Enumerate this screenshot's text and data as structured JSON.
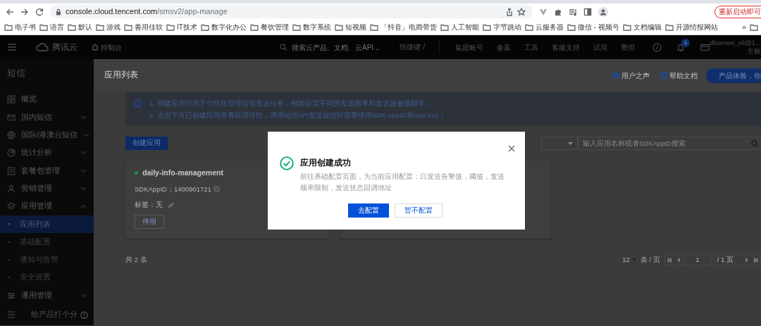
{
  "browser": {
    "url_host": "console.cloud.tencent.com",
    "url_path": "/smsv2/app-manage",
    "relaunch_button": "重新启动即可",
    "bookmarks": [
      "电子书",
      "语言",
      "默认",
      "游戏",
      "善用佳软",
      "IT技术",
      "数字化办公",
      "餐饮管理",
      "数字系统",
      "短视频",
      "「抖音」电商带货",
      "人工智能",
      "字节跳动",
      "云服务器",
      "微信 - 视频号",
      "文档编辑",
      "开源情报网站"
    ],
    "more": "»"
  },
  "header": {
    "brand": "腾讯云",
    "console": "控制台",
    "search": {
      "placeholder": "搜索云产品、文档、云API..."
    },
    "shortcut": "快捷键 /",
    "nav": [
      "集团账号",
      "备案",
      "工具",
      "客服支持",
      "试用",
      "费用"
    ],
    "notifications_badge": "1",
    "user": {
      "name": "dkseven_eli@1...",
      "role": "主账"
    }
  },
  "sidebar": {
    "title": "短信",
    "items": [
      {
        "label": "概览",
        "kind": "link"
      },
      {
        "label": "国内短信",
        "kind": "group",
        "expanded": false
      },
      {
        "label": "国际/港澳台短信",
        "kind": "group",
        "expanded": false
      },
      {
        "label": "统计分析",
        "kind": "group",
        "expanded": false
      },
      {
        "label": "套餐包管理",
        "kind": "group",
        "expanded": false
      },
      {
        "label": "营销管理",
        "kind": "group",
        "expanded": false
      },
      {
        "label": "应用管理",
        "kind": "group",
        "expanded": true,
        "children": [
          {
            "label": "应用列表",
            "selected": true
          },
          {
            "label": "基础配置",
            "selected": false
          },
          {
            "label": "通知与告警",
            "selected": false
          },
          {
            "label": "安全设置",
            "selected": false
          }
        ]
      },
      {
        "label": "通用管理",
        "kind": "group",
        "expanded": false
      }
    ],
    "footer": "给产品打个分"
  },
  "page": {
    "title": "应用列表",
    "links": [
      "用户之声",
      "帮助文档"
    ],
    "promo": "产品体验，你",
    "notice": [
      "1. 创建应用可用于个性化管理短信发送任务，例如设置不同的发送频率和发送超量提醒等；",
      "2. 点击下方已创建应用查看应用详情，调用短信API发送短信时需要使用SDK AppID和App Key；"
    ],
    "create_button": "创建应用",
    "search": {
      "placeholder": "输入应用名称或者SDKAppID搜索"
    },
    "apps": [
      {
        "name": "daily-info-management",
        "color": "#1f8a45",
        "sdk_app_id": "SDKAppID：1400901721",
        "tag": "标签：无",
        "disable_button": "停用"
      }
    ],
    "total": "共 2 条",
    "pagination": {
      "page_size": "12",
      "per_page": "条 / 页",
      "page": "1",
      "total_pages": "/ 1 页"
    }
  },
  "dialog": {
    "title": "应用创建成功",
    "message": "前往基础配置页面，为当前应用配置：日发送告警值，阈值，发送频率限制，发送状态回调地址",
    "confirm_button": "去配置",
    "cancel_button": "暂不配置"
  }
}
